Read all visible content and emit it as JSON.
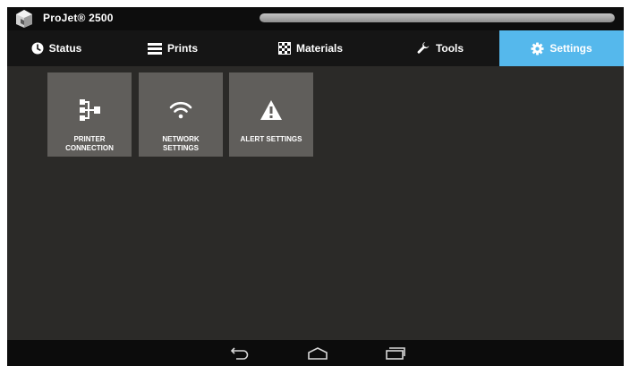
{
  "app": {
    "title": "ProJet® 2500",
    "progress": 1.0
  },
  "tabs": [
    {
      "label": "Status",
      "icon": "clock-icon",
      "active": false
    },
    {
      "label": "Prints",
      "icon": "list-icon",
      "active": false
    },
    {
      "label": "Materials",
      "icon": "checkerboard-icon",
      "active": false
    },
    {
      "label": "Tools",
      "icon": "wrench-icon",
      "active": false
    },
    {
      "label": "Settings",
      "icon": "gear-icon",
      "active": true
    }
  ],
  "tiles": [
    {
      "label": "PRINTER\nCONNECTION",
      "icon": "connection-icon"
    },
    {
      "label": "NETWORK\nSETTINGS",
      "icon": "wifi-icon"
    },
    {
      "label": "ALERT SETTINGS",
      "icon": "warning-icon"
    }
  ],
  "navbar": {
    "back": "back-icon",
    "home": "home-icon",
    "recents": "recents-icon"
  },
  "colors": {
    "accent": "#55b8ec",
    "tile": "#605e5b",
    "background": "#2b2a28",
    "tabbar": "#151515"
  }
}
